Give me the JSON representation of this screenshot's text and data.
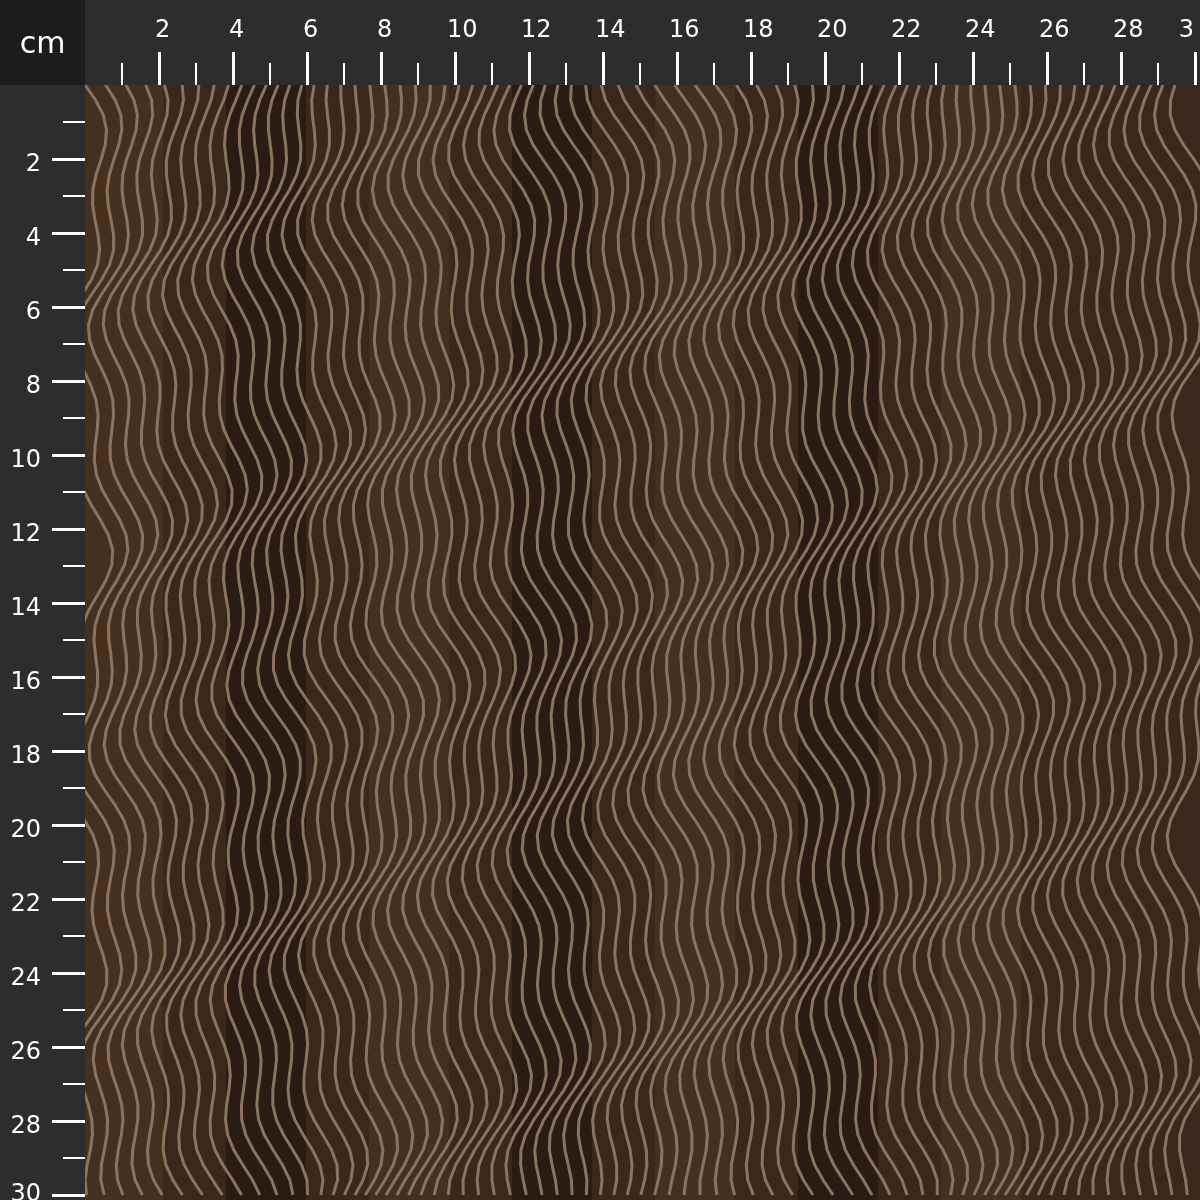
{
  "corner": {
    "unit": "cm"
  },
  "top_ruler": {
    "labels": [
      "2",
      "4",
      "6",
      "8",
      "10",
      "12",
      "14",
      "16",
      "18",
      "20",
      "22",
      "24",
      "26",
      "28",
      "3"
    ]
  },
  "left_ruler": {
    "labels": [
      "2",
      "4",
      "6",
      "8",
      "10",
      "12",
      "14",
      "16",
      "18",
      "20",
      "22",
      "24",
      "26",
      "28",
      "30"
    ]
  }
}
